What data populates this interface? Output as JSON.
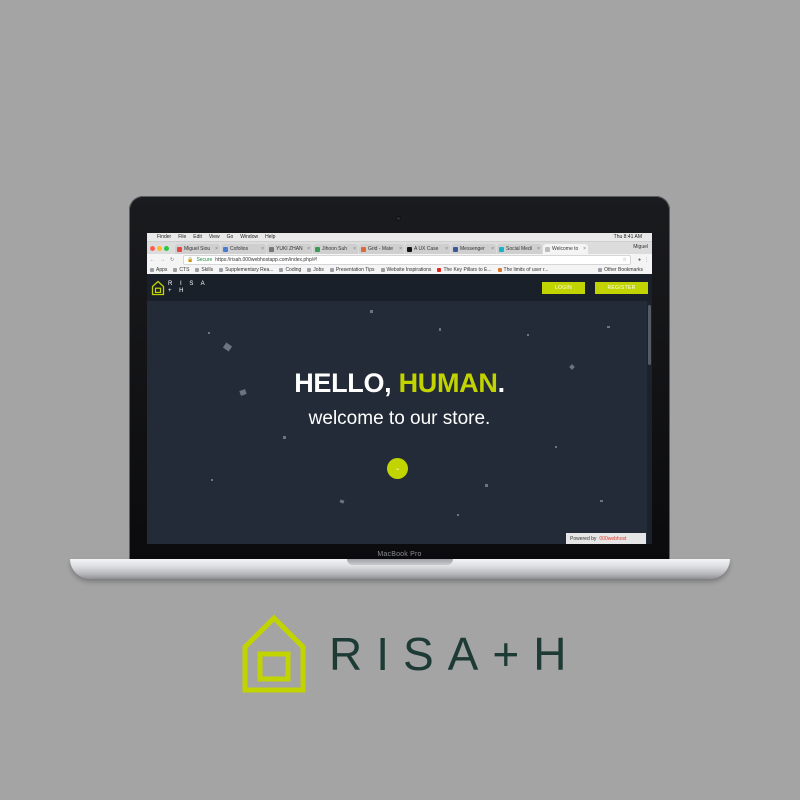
{
  "menubar": {
    "apple": "",
    "items": [
      "Finder",
      "File",
      "Edit",
      "View",
      "Go",
      "Window",
      "Help"
    ],
    "right": "Thu 8:41 AM"
  },
  "tabs": [
    {
      "label": "Miguel Siou",
      "color": "#e8453c"
    },
    {
      "label": "Cofolios",
      "color": "#4a7bd0"
    },
    {
      "label": "YUKI ZHAN",
      "color": "#777777"
    },
    {
      "label": "Jihoon Suh",
      "color": "#3a9a55"
    },
    {
      "label": "Grid - Mate",
      "color": "#d96b3a"
    },
    {
      "label": "A UX Case",
      "color": "#111111"
    },
    {
      "label": "Messenger",
      "color": "#3b5998"
    },
    {
      "label": "Social Medi",
      "color": "#1bb3c6"
    },
    {
      "label": "Welcome to",
      "color": "#bbbbbb"
    }
  ],
  "profile": "Miguel",
  "address": {
    "secure_label": "Secure",
    "url": "https://risah.000webhostapp.com/index.php/#!"
  },
  "bookmarks": {
    "items": [
      "Apps",
      "CTS",
      "Skills",
      "Supplementary Rea...",
      "Coding",
      "Jobs",
      "Presentation Tips",
      "Website Inspirations",
      "The Key Pillars to E...",
      "The limits of user r..."
    ],
    "other": "Other Bookmarks"
  },
  "site": {
    "logo_line1": "R I S A",
    "logo_line2": "+ H",
    "login_label": "LOGIN",
    "register_label": "REGISTER",
    "hero_hello": "HELLO, ",
    "hero_human": "HUMAN",
    "hero_period": ".",
    "hero_sub": "welcome to our store.",
    "scroll_icon": "⌄",
    "powered_by": "Powered by",
    "powered_brand": "000webhost",
    "accent_color": "#c2d400"
  },
  "laptop": {
    "model": "MacBook Pro"
  },
  "brand": {
    "name": "RISA+H",
    "color": "#c2d400"
  }
}
